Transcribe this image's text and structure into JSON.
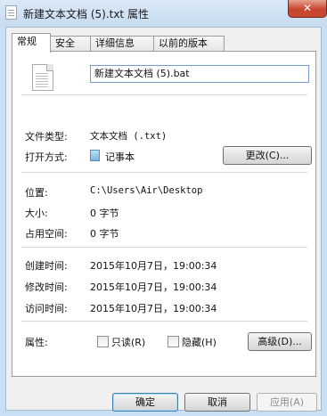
{
  "window": {
    "title": "新建文本文档 (5).txt 属性",
    "close_glyph": "✕"
  },
  "tabs": [
    {
      "label": "常规",
      "active": true
    },
    {
      "label": "安全",
      "active": false
    },
    {
      "label": "详细信息",
      "active": false
    },
    {
      "label": "以前的版本",
      "active": false
    }
  ],
  "general": {
    "file_name": "新建文本文档 (5).bat",
    "file_type_label": "文件类型:",
    "file_type_value": "文本文档 (.txt)",
    "open_with_label": "打开方式:",
    "open_with_value": "记事本",
    "change_button": "更改(C)...",
    "location_label": "位置:",
    "location_value": "C:\\Users\\Air\\Desktop",
    "size_label": "大小:",
    "size_value": "0 字节",
    "disk_size_label": "占用空间:",
    "disk_size_value": "0 字节",
    "created_label": "创建时间:",
    "created_value": "2015年10月7日，19:00:34",
    "modified_label": "修改时间:",
    "modified_value": "2015年10月7日，19:00:34",
    "accessed_label": "访问时间:",
    "accessed_value": "2015年10月7日，19:00:34",
    "attributes_label": "属性:",
    "readonly_label": "只读(R)",
    "readonly_checked": false,
    "hidden_label": "隐藏(H)",
    "hidden_checked": false,
    "advanced_button": "高级(D)..."
  },
  "footer": {
    "ok": "确定",
    "cancel": "取消",
    "apply": "应用(A)"
  }
}
